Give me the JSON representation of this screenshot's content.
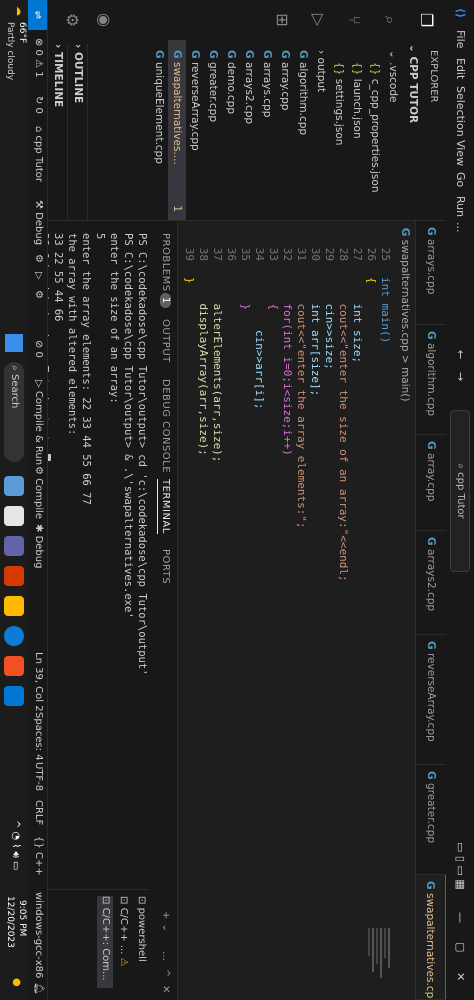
{
  "menu": [
    "File",
    "Edit",
    "Selection",
    "View",
    "Go",
    "Run",
    "..."
  ],
  "search_box": "cpp Tutor",
  "activity_icons": [
    "explorer-icon",
    "search-icon",
    "source-control-icon",
    "run-debug-icon",
    "extensions-icon",
    "account-icon",
    "settings-gear-icon"
  ],
  "sidebar": {
    "header": "EXPLORER",
    "folder": "CPP TUTOR",
    "items": [
      {
        "label": ".vscode",
        "kind": "folder"
      },
      {
        "label": "c_cpp_properties.json",
        "kind": "json"
      },
      {
        "label": "launch.json",
        "kind": "json"
      },
      {
        "label": "settings.json",
        "kind": "json"
      },
      {
        "label": "output",
        "kind": "folder"
      },
      {
        "label": "algorithm.cpp",
        "kind": "cpp"
      },
      {
        "label": "array.cpp",
        "kind": "cpp"
      },
      {
        "label": "arrays.cpp",
        "kind": "cpp"
      },
      {
        "label": "arrays2.cpp",
        "kind": "cpp"
      },
      {
        "label": "demo.cpp",
        "kind": "cpp"
      },
      {
        "label": "greater.cpp",
        "kind": "cpp"
      },
      {
        "label": "reverseArray.cpp",
        "kind": "cpp"
      },
      {
        "label": "swapalternatives....",
        "kind": "cpp",
        "badge": "1",
        "active": true
      },
      {
        "label": "uniqueElement.cpp",
        "kind": "cpp"
      }
    ],
    "outline": "OUTLINE",
    "timeline": "TIMELINE"
  },
  "tabs": [
    {
      "label": "arrays.cpp"
    },
    {
      "label": "algorithm.cpp"
    },
    {
      "label": "array.cpp"
    },
    {
      "label": "arrays2.cpp"
    },
    {
      "label": "reverseArray.cpp"
    },
    {
      "label": "greater.cpp"
    },
    {
      "label": "swapalternatives.cpp 1",
      "active": true
    }
  ],
  "breadcrumb": "swapalternatives.cpp > main()",
  "editor": {
    "line_numbers": [
      "25",
      "26",
      "27",
      "28",
      "29",
      "30",
      "31",
      "32",
      "33",
      "34",
      "35",
      "36",
      "37",
      "38",
      "39"
    ],
    "lines": [
      "int main()",
      "{",
      "    int size;",
      "    cout<<\"enter the size of an array:\"<<endl;",
      "    cin>>size;",
      "    int arr[size];",
      "    cout<<\"enter the array elements:\";",
      "    for(int i=0;i<size;i++)",
      "    {",
      "        cin>>arr[i];",
      "    }",
      "",
      "    alterElements(arr,size);",
      "    displayArray(arr,size);",
      "}"
    ]
  },
  "panel": {
    "tabs": [
      "PROBLEMS",
      "OUTPUT",
      "DEBUG CONSOLE",
      "TERMINAL",
      "PORTS"
    ],
    "problems_badge": "1",
    "active_tab": "TERMINAL",
    "terminal_lines": [
      "PS C:\\codekadose\\cpp Tutor\\output> cd 'c:\\codekadose\\cpp Tutor\\output'",
      "PS C:\\codekadose\\cpp Tutor\\output> & .\\'swapalternatives.exe'",
      "enter the size of an array:",
      "5",
      "enter the array elements: 22 33 44 55 66 77",
      "the array with altered elements:",
      "33 22 55 44 66",
      "PS C:\\codekadose\\cpp Tutor\\output> "
    ],
    "terminals": [
      "powershell",
      "C/C++ ...",
      "C/C++: Com..."
    ]
  },
  "status": {
    "left": [
      "⊗ 0 ⚠ 1",
      "↻ 0",
      "cpp Tutor",
      "Debug",
      "⚙",
      "▷",
      "⚙",
      "⊘ 0",
      "Compile & Run",
      "Compile",
      "Debug"
    ],
    "right": [
      "Ln 39, Col 2",
      "Spaces: 4",
      "UTF-8",
      "CRLF",
      "{} C++",
      "windows-gcc-x86"
    ]
  },
  "taskbar": {
    "weather_temp": "66°F",
    "weather_desc": "Partly cloudy",
    "search": "Search",
    "time": "9:05 PM",
    "date": "12/20/2023"
  }
}
